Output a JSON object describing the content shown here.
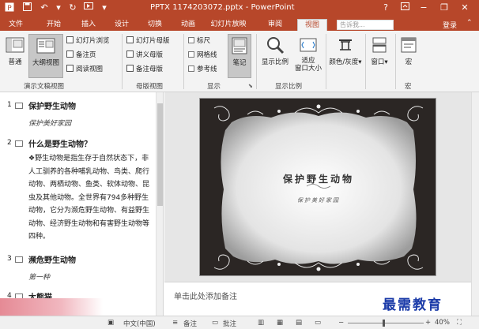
{
  "window": {
    "title": "PPTX 1174203072.pptx - PowerPoint",
    "help_label": "?"
  },
  "tabs": [
    {
      "label": "文件"
    },
    {
      "label": "开始"
    },
    {
      "label": "插入"
    },
    {
      "label": "设计"
    },
    {
      "label": "切换"
    },
    {
      "label": "动画"
    },
    {
      "label": "幻灯片放映"
    },
    {
      "label": "审阅"
    },
    {
      "label": "视图",
      "active": true
    }
  ],
  "search": {
    "placeholder": "告诉我..."
  },
  "account": {
    "login_label": "登录"
  },
  "ribbon": {
    "presentation_views": {
      "group_label": "演示文稿视图",
      "normal": "普通",
      "outline": "大纲视图",
      "slide_sorter": "幻灯片浏览",
      "notes_page": "备注页",
      "reading_view": "阅读视图"
    },
    "master_views": {
      "group_label": "母版视图",
      "slide_master": "幻灯片母版",
      "handout_master": "讲义母版",
      "notes_master": "备注母版"
    },
    "show": {
      "group_label": "显示",
      "ruler": "标尺",
      "gridlines": "网格线",
      "guides": "参考线",
      "notes": "笔记"
    },
    "zoom": {
      "group_label": "显示比例",
      "zoom": "显示比例",
      "fit_window": "适应\n窗口大小"
    },
    "color": {
      "label": "颜色/灰度"
    },
    "window": {
      "label": "窗口"
    },
    "macros": {
      "label": "宏",
      "group_label": "宏"
    }
  },
  "outline": {
    "slides": [
      {
        "number": "1",
        "title": "保护野生动物",
        "subtitle": "保护美好家园"
      },
      {
        "number": "2",
        "title": "什么是野生动物？",
        "body": "❖野生动物是指生存于自然状态下，非人工驯养的各种哺乳动物、鸟类、爬行动物、两栖动物、鱼类、软体动物、昆虫及其他动物。全世界有794多种野生动物，它分为濒危野生动物、有益野生动物、经济野生动物和有害野生动物等四种。"
      },
      {
        "number": "3",
        "title": "濒危野生动物",
        "subtitle": "第一种"
      },
      {
        "number": "4",
        "title": "大熊猫"
      }
    ]
  },
  "slide": {
    "title": "保护野生动物",
    "subtitle": "保护美好家园"
  },
  "notes": {
    "placeholder": "单击此处添加备注"
  },
  "statusbar": {
    "language": "中文(中国)",
    "notes_label": "备注",
    "comments_label": "批注",
    "zoom_level": "40%",
    "zoom_fraction": 0.4
  },
  "watermark": {
    "text": "最需教育"
  },
  "colors": {
    "accent": "#b7472a",
    "watermark": "#1a3aa8"
  }
}
